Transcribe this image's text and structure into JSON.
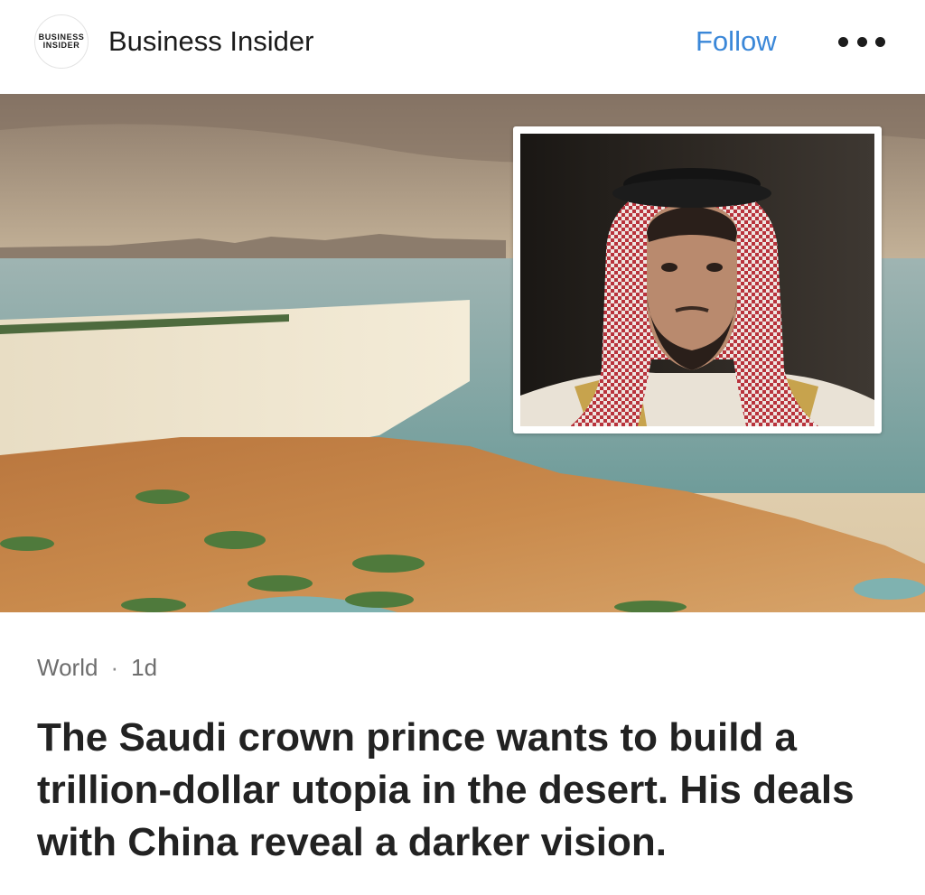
{
  "header": {
    "logo_line1": "BUSINESS",
    "logo_line2": "INSIDER",
    "publisher": "Business Insider",
    "follow_label": "Follow",
    "more_icon": "ellipsis-icon"
  },
  "hero": {
    "background": "desert-city-rendering",
    "inset": "portrait-photo"
  },
  "article": {
    "category": "World",
    "separator": "·",
    "age": "1d",
    "headline": "The Saudi crown prince wants to build a trillion-dollar utopia in the desert. His deals with China reveal a darker vision."
  },
  "colors": {
    "accent": "#3a87d8",
    "text": "#222222",
    "muted": "#6e6e6e"
  }
}
